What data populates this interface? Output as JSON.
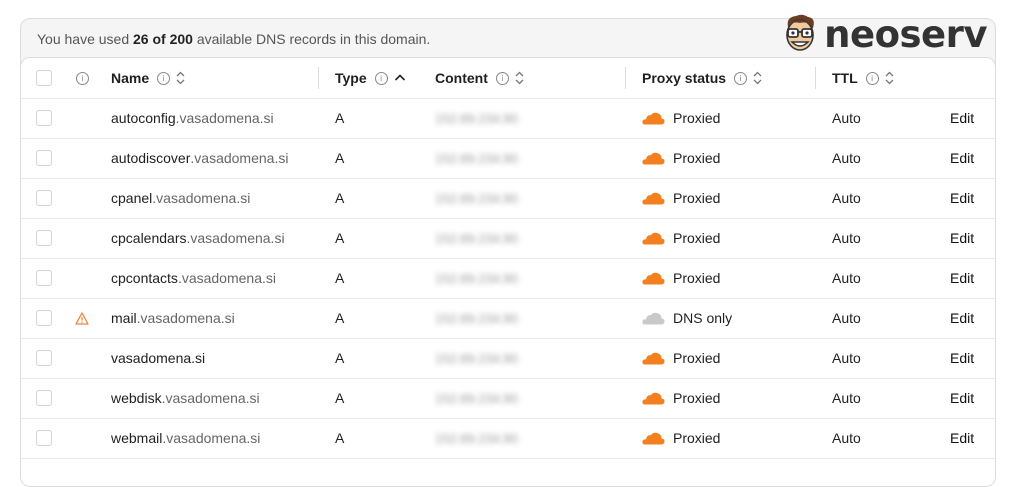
{
  "usage": {
    "prefix": "You have used ",
    "count": "26 of 200",
    "suffix": " available DNS records in this domain."
  },
  "brand": {
    "name": "neoserv"
  },
  "columns": {
    "name": "Name",
    "type": "Type",
    "content": "Content",
    "proxy": "Proxy status",
    "ttl": "TTL"
  },
  "rows": [
    {
      "host": "autoconfig",
      "domain": ".vasadomena.si",
      "type": "A",
      "content": "152.89.234.80",
      "proxy": "Proxied",
      "ttl": "Auto",
      "edit": "Edit",
      "warning": false
    },
    {
      "host": "autodiscover",
      "domain": ".vasadomena.si",
      "type": "A",
      "content": "152.89.234.80",
      "proxy": "Proxied",
      "ttl": "Auto",
      "edit": "Edit",
      "warning": false
    },
    {
      "host": "cpanel",
      "domain": ".vasadomena.si",
      "type": "A",
      "content": "152.89.234.80",
      "proxy": "Proxied",
      "ttl": "Auto",
      "edit": "Edit",
      "warning": false
    },
    {
      "host": "cpcalendars",
      "domain": ".vasadomena.si",
      "type": "A",
      "content": "152.89.234.80",
      "proxy": "Proxied",
      "ttl": "Auto",
      "edit": "Edit",
      "warning": false
    },
    {
      "host": "cpcontacts",
      "domain": ".vasadomena.si",
      "type": "A",
      "content": "152.89.234.80",
      "proxy": "Proxied",
      "ttl": "Auto",
      "edit": "Edit",
      "warning": false
    },
    {
      "host": "mail",
      "domain": ".vasadomena.si",
      "type": "A",
      "content": "152.89.234.80",
      "proxy": "DNS only",
      "ttl": "Auto",
      "edit": "Edit",
      "warning": true
    },
    {
      "host": "vasadomena.si",
      "domain": "",
      "type": "A",
      "content": "152.89.234.80",
      "proxy": "Proxied",
      "ttl": "Auto",
      "edit": "Edit",
      "warning": false
    },
    {
      "host": "webdisk",
      "domain": ".vasadomena.si",
      "type": "A",
      "content": "152.89.234.80",
      "proxy": "Proxied",
      "ttl": "Auto",
      "edit": "Edit",
      "warning": false
    },
    {
      "host": "webmail",
      "domain": ".vasadomena.si",
      "type": "A",
      "content": "152.89.234.80",
      "proxy": "Proxied",
      "ttl": "Auto",
      "edit": "Edit",
      "warning": false
    }
  ],
  "colors": {
    "proxied_cloud": "#f38020",
    "dns_only_cloud": "#c9c9c9",
    "warning": "#e8863a"
  },
  "icons": {
    "info": "info-icon",
    "sort": "sort-icon",
    "sort_asc": "sort-ascending-icon",
    "warning": "warning-icon",
    "cloud": "cloud-icon"
  }
}
